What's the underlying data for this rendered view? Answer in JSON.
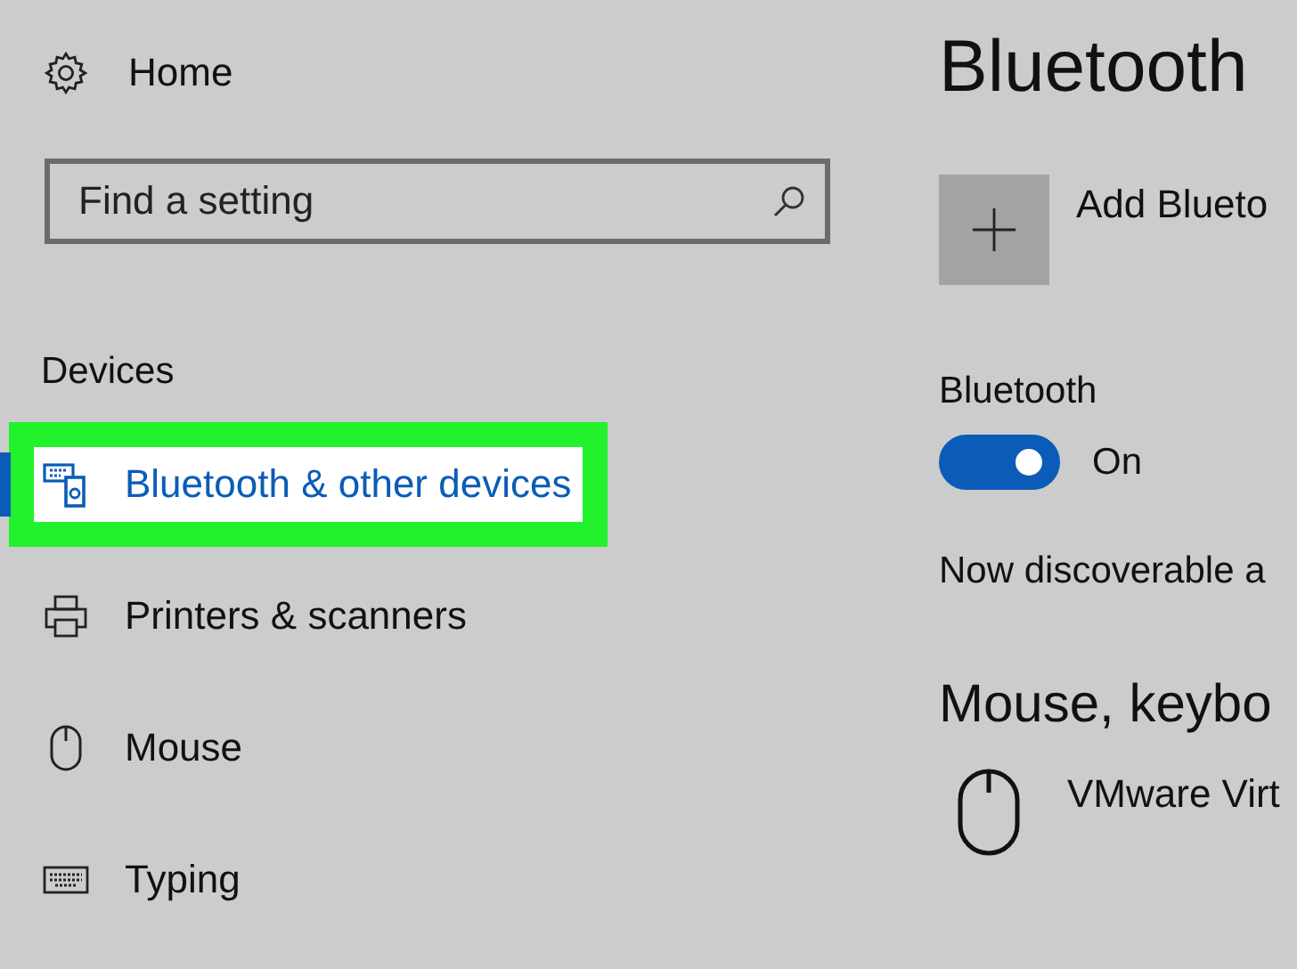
{
  "sidebar": {
    "home": {
      "label": "Home"
    },
    "search": {
      "placeholder": "Find a setting"
    },
    "section": "Devices",
    "items": [
      {
        "label": "Bluetooth & other devices",
        "kind": "bluetooth-devices",
        "selected": true,
        "annotated": true
      },
      {
        "label": "Printers & scanners",
        "kind": "printer",
        "selected": false,
        "annotated": false
      },
      {
        "label": "Mouse",
        "kind": "mouse",
        "selected": false,
        "annotated": false
      },
      {
        "label": "Typing",
        "kind": "keyboard",
        "selected": false,
        "annotated": false
      }
    ]
  },
  "content": {
    "title": "Bluetooth",
    "add_device": {
      "label": "Add Blueto"
    },
    "bluetooth": {
      "label": "Bluetooth",
      "on": true,
      "state_text": "On"
    },
    "discoverable": "Now discoverable a",
    "section": "Mouse, keybo",
    "devices": [
      {
        "name": "VMware Virt",
        "kind": "mouse"
      }
    ]
  }
}
